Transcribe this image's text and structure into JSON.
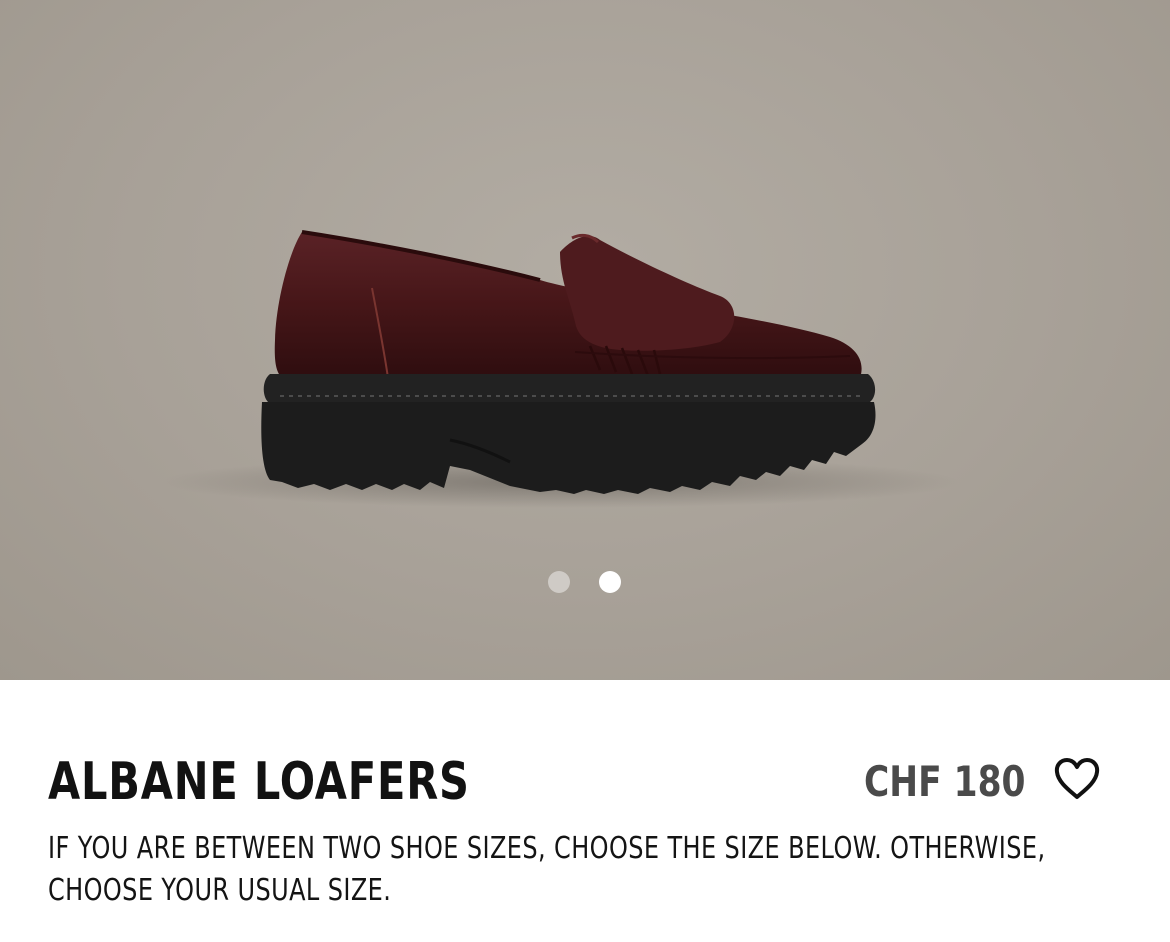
{
  "product": {
    "image_alt": "burgundy leather loafer with chunky black lug sole",
    "name": "ALBANE LOAFERS",
    "price": "CHF 180",
    "size_note": "IF YOU ARE BETWEEN TWO SHOE SIZES, CHOOSE THE SIZE BELOW. OTHERWISE, CHOOSE YOUR USUAL SIZE.",
    "favorite_icon": "heart-outline-icon"
  },
  "carousel": {
    "total_slides": 2,
    "active_slide": 2
  },
  "colors": {
    "hero_background": "#a8a198",
    "leather": "#4a1a1c",
    "sole": "#1c1c1c",
    "title_text": "#121212",
    "price_text": "#4a4a4a"
  }
}
